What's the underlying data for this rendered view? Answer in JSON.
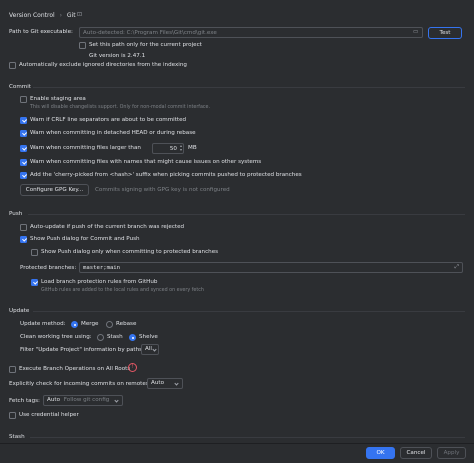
{
  "breadcrumb": {
    "root": "Version Control",
    "sep": "›",
    "leaf": "Git"
  },
  "git_path": {
    "label": "Path to Git executable:",
    "placeholder": "Auto-detected: C:\\Program Files\\Git\\cmd\\git.exe",
    "test_label": "Test",
    "project_only_label": "Set this path only for the current project",
    "project_only_checked": false,
    "version_text": "Git version is 2.47.1"
  },
  "auto_exclude": {
    "label": "Automatically exclude ignored directories from the indexing",
    "checked": false
  },
  "commit": {
    "title": "Commit",
    "staging": {
      "label": "Enable staging area",
      "hint": "This will disable changelists support. Only for non-modal commit interface.",
      "checked": false
    },
    "crlf": {
      "label": "Warn if CRLF line separators are about to be committed",
      "checked": true
    },
    "detached": {
      "label": "Warn when committing in detached HEAD or during rebase",
      "checked": true
    },
    "large_files": {
      "label": "Warn when committing files larger than",
      "value": "50",
      "unit": "MB",
      "checked": true
    },
    "names": {
      "label": "Warn when committing files with names that might cause issues on other systems",
      "checked": true
    },
    "cherry": {
      "label": "Add the 'cherry-picked from <hash>' suffix when picking commits pushed to protected branches",
      "checked": true
    },
    "gpg_button": "Configure GPG Key...",
    "gpg_status": "Commits signing with GPG key is not configured"
  },
  "push": {
    "title": "Push",
    "auto_update": {
      "label": "Auto-update if push of the current branch was rejected",
      "checked": false
    },
    "show_dialog": {
      "label": "Show Push dialog for Commit and Push",
      "checked": true
    },
    "protected_only": {
      "label": "Show Push dialog only when committing to protected branches",
      "checked": false
    },
    "protected_label": "Protected branches:",
    "protected_value": "master;main",
    "load_rules": {
      "label": "Load branch protection rules from GitHub",
      "checked": true
    },
    "load_rules_hint": "GitHub rules are added to the local rules and synced on every fetch"
  },
  "update": {
    "title": "Update",
    "method_label": "Update method:",
    "merge": "Merge",
    "rebase": "Rebase",
    "method_selected": "Merge",
    "clean_label": "Clean working tree using:",
    "stash": "Stash",
    "shelve": "Shelve",
    "clean_selected": "Shelve",
    "filter_label": "Filter \"Update Project\" information by paths:",
    "filter_value": "All"
  },
  "root_ops": {
    "label": "Execute Branch Operations on All Roots",
    "checked": false
  },
  "incoming": {
    "label": "Explicitly check for incoming commits on remotes:",
    "value": "Auto"
  },
  "fetch_tags": {
    "label": "Fetch tags:",
    "value": "Auto",
    "hint": "Follow git config"
  },
  "credential": {
    "label": "Use credential helper",
    "checked": false
  },
  "stash_section": {
    "title": "Stash"
  },
  "footer": {
    "ok": "OK",
    "cancel": "Cancel",
    "apply": "Apply"
  },
  "colors": {
    "accent": "#3574f0",
    "background": "#2b2d30",
    "warning": "#e55765"
  }
}
